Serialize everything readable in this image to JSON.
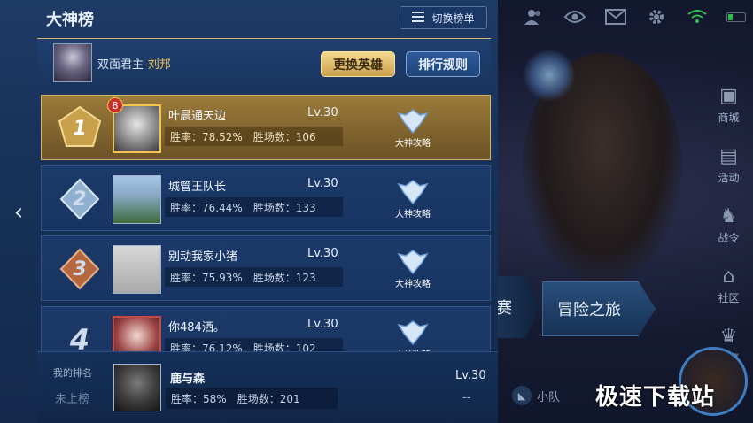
{
  "panel": {
    "title": "大神榜",
    "switch_label": "切换榜单"
  },
  "hero": {
    "name_prefix": "双面君主-",
    "name_highlight": "刘邦",
    "change_hero_label": "更换英雄",
    "rank_rule_label": "排行规则"
  },
  "rankings": [
    {
      "rank": "1",
      "name": "叶晨通天边",
      "level": "Lv.30",
      "win_rate": "胜率：78.52%",
      "wins": "胜场数：106",
      "guide": "大神攻略",
      "badge": "8"
    },
    {
      "rank": "2",
      "name": "城管王队长",
      "level": "Lv.30",
      "win_rate": "胜率：76.44%",
      "wins": "胜场数：133",
      "guide": "大神攻略"
    },
    {
      "rank": "3",
      "name": "别动我家小猪",
      "level": "Lv.30",
      "win_rate": "胜率：75.93%",
      "wins": "胜场数：123",
      "guide": "大神攻略"
    },
    {
      "rank": "4",
      "name": "你484洒。",
      "level": "Lv.30",
      "win_rate": "胜率：76.12%",
      "wins": "胜场数：102",
      "guide": "大神攻略"
    }
  ],
  "my_rank": {
    "label": "我的排名",
    "status": "未上榜",
    "name": "鹿与森",
    "level": "Lv.30",
    "win_rate": "胜率：58%",
    "wins": "胜场数：201",
    "rank_value": "--"
  },
  "side_menu": [
    {
      "label": "商城",
      "icon": "shop-icon"
    },
    {
      "label": "活动",
      "icon": "activity-icon"
    },
    {
      "label": "战令",
      "icon": "battle-pass-icon"
    },
    {
      "label": "社区",
      "icon": "community-icon"
    },
    {
      "label": "赛事",
      "icon": "trophy-icon"
    }
  ],
  "buttons": {
    "adventure_label": "冒险之旅",
    "adventure_prev": "赛",
    "team_label": "小队"
  },
  "watermark": "极速下载站",
  "colors": {
    "gold_accent": "#f0c35a",
    "panel_blue": "#173158",
    "wifi_green": "#2bbd4d"
  }
}
